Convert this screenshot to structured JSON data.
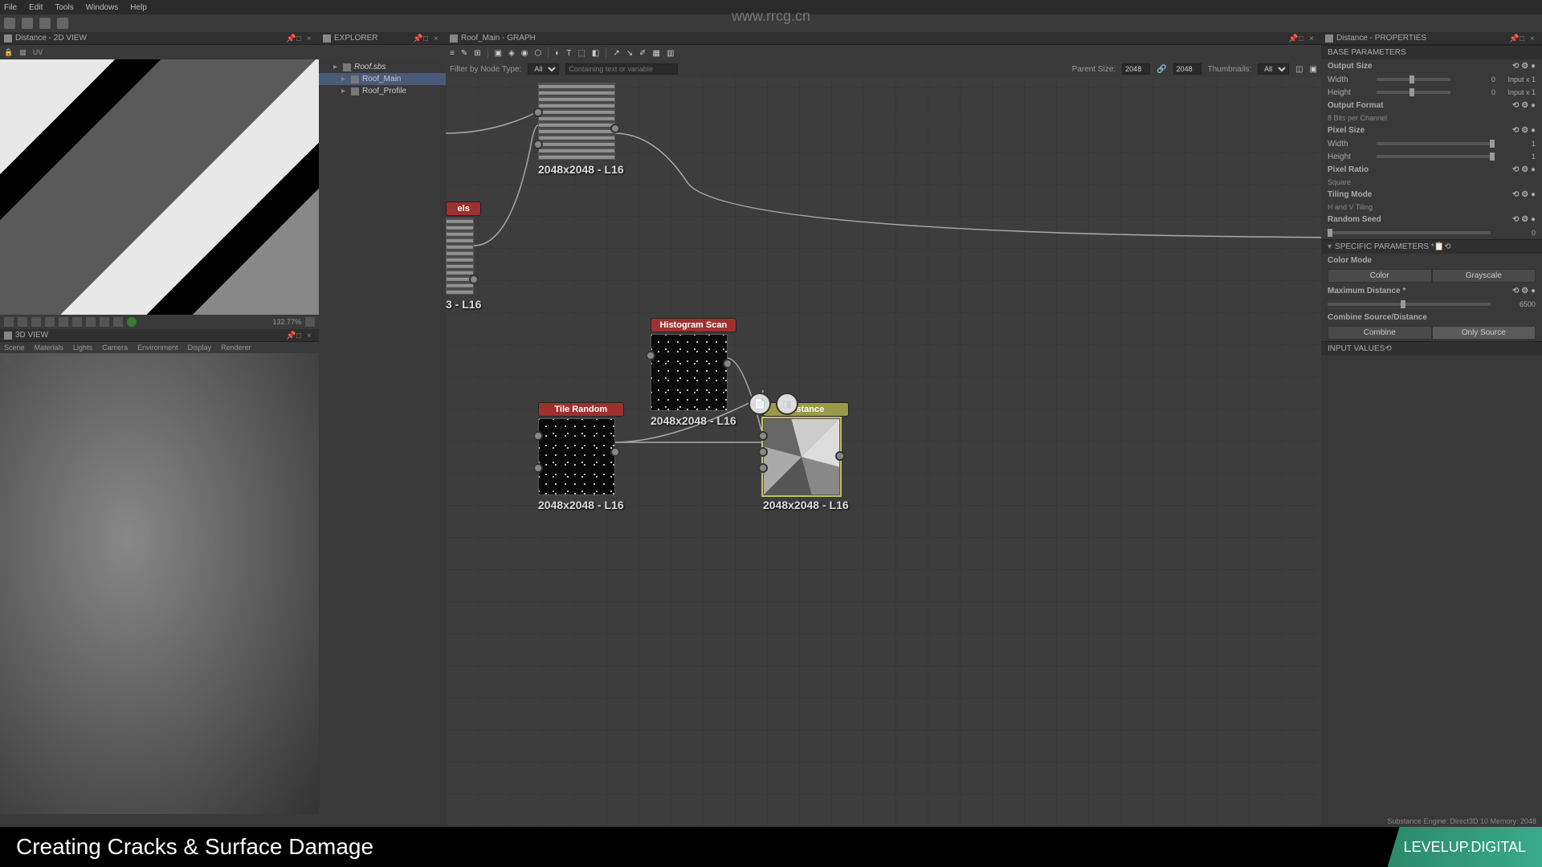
{
  "menubar": {
    "file": "File",
    "edit": "Edit",
    "tools": "Tools",
    "windows": "Windows",
    "help": "Help"
  },
  "panels": {
    "view2d": {
      "title": "Distance - 2D VIEW",
      "zoom": "132.77%",
      "uv_label": "UV"
    },
    "view3d": {
      "title": "3D VIEW",
      "menus": [
        "Scene",
        "Materials",
        "Lights",
        "Camera",
        "Environment",
        "Display",
        "Renderer"
      ]
    },
    "explorer": {
      "title": "EXPLORER",
      "items": [
        {
          "label": "Roof.sbs",
          "italic": true,
          "indent": 0
        },
        {
          "label": "Roof_Main",
          "indent": 1,
          "selected": true
        },
        {
          "label": "Roof_Profile",
          "indent": 1
        }
      ]
    },
    "graph": {
      "title": "Roof_Main - GRAPH",
      "filter_label": "Filter by Node Type:",
      "filter_value": "All",
      "containing_label": "Containing text or variable",
      "parent_label": "Parent Size:",
      "parent_w": "2048",
      "parent_h": "2048",
      "thumb_label": "Thumbnails:",
      "thumb_value": "All"
    },
    "props": {
      "title": "Distance - PROPERTIES",
      "sections": {
        "base": "BASE PARAMETERS",
        "specific": "SPECIFIC PARAMETERS *",
        "input": "INPUT VALUES"
      },
      "output_size": "Output Size",
      "width": "Width",
      "height": "Height",
      "width_val": "0",
      "height_val": "0",
      "input_x1": "Input x 1",
      "output_format": "Output Format",
      "format_val": "8 Bits per Channel",
      "pixel_size": "Pixel Size",
      "pixel_ratio": "Pixel Ratio",
      "pixel_ratio_val": "Square",
      "tiling_mode": "Tiling Mode",
      "tiling_val": "H and V Tiling",
      "random_seed": "Random Seed",
      "seed_val": "0",
      "color_mode": "Color Mode",
      "color": "Color",
      "grayscale": "Grayscale",
      "max_dist": "Maximum Distance *",
      "max_dist_val": "6500",
      "combine": "Combine Source/Distance",
      "combine_opt": "Combine",
      "only_source": "Only Source"
    }
  },
  "nodes": {
    "node1": {
      "label": "2048x2048 - L16"
    },
    "node2": {
      "title": "els",
      "label": "3 - L16"
    },
    "hist": {
      "title": "Histogram Scan",
      "label": "2048x2048 - L16"
    },
    "tile": {
      "title": "Tile Random",
      "label": "2048x2048 - L16"
    },
    "dist": {
      "title": "Distance",
      "label": "2048x2048 - L16"
    }
  },
  "footer": {
    "status": "Substance Engine: Direct3D 10   Memory: 2048",
    "title": "Creating Cracks & Surface Damage",
    "brand": "LEVELUP.DIGITAL"
  },
  "watermark": "www.rrcg.cn"
}
